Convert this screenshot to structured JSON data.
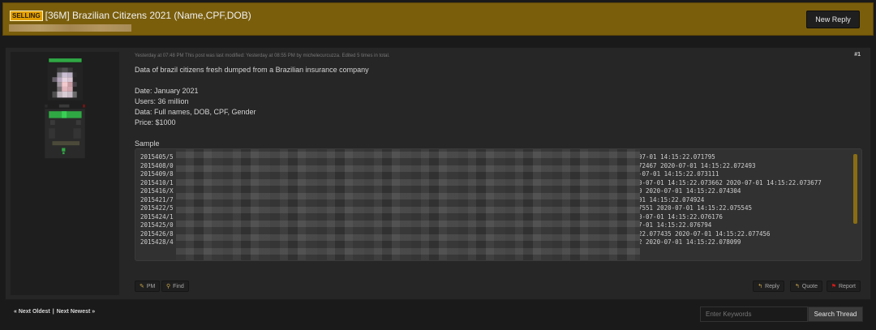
{
  "thread": {
    "prefix_badge": "SELLING",
    "title": "[36M] Brazilian Citizens 2021 (Name,CPF,DOB)",
    "new_reply_label": "New Reply"
  },
  "post": {
    "number": "#1",
    "meta": "Yesterday at 07:48 PM  This post was last modified: Yesterday at 08:55 PM by michelecurcuzza. Edited 5 times in total.",
    "body": "Data of brazil citizens fresh dumped from a Brazilian insurance company\n\nDate: January 2021\nUsers: 36 million\nData: Full names, DOB, CPF, Gender\nPrice: $1000",
    "sample_label": "Sample",
    "code_lines": [
      {
        "prefix": "2015405/5",
        "suffix": "07-01 14:15:22.071795"
      },
      {
        "prefix": "2015408/0",
        "suffix": "72467 2020-07-01 14:15:22.072493"
      },
      {
        "prefix": "2015409/8",
        "suffix": "-07-01 14:15:22.073111"
      },
      {
        "prefix": "2015410/1",
        "suffix": "0-07-01 14:15:22.073662 2020-07-01 14:15:22.073677"
      },
      {
        "prefix": "2015416/X",
        "suffix": "0 2020-07-01 14:15:22.074304"
      },
      {
        "prefix": "2015421/7",
        "suffix": "01 14:15:22.074924"
      },
      {
        "prefix": "2015422/5",
        "suffix": "7551 2020-07-01 14:15:22.075545"
      },
      {
        "prefix": "2015424/1",
        "suffix": "0-07-01 14:15:22.076176"
      },
      {
        "prefix": "2015425/0",
        "suffix": "7-01 14:15:22.076794"
      },
      {
        "prefix": "2015426/8",
        "suffix": "22.077435 2020-07-01 14:15:22.077456"
      },
      {
        "prefix": "2015428/4",
        "suffix": "2 2020-07-01 14:15:22.078099"
      }
    ],
    "actions": {
      "pm": "PM",
      "find": "Find",
      "reply": "Reply",
      "quote": "Quote",
      "report": "Report"
    }
  },
  "navigation": {
    "next_oldest": "« Next Oldest",
    "separator": "|",
    "next_newest": "Next Newest »"
  },
  "search": {
    "placeholder": "Enter Keywords",
    "button_label": "Search Thread"
  },
  "colors": {
    "header_bg": "#7a5e0c",
    "badge_bg": "#e2a000",
    "post_bg": "#262626",
    "scroll_thumb": "#8a6d12",
    "report_icon": "#d41a1a"
  }
}
